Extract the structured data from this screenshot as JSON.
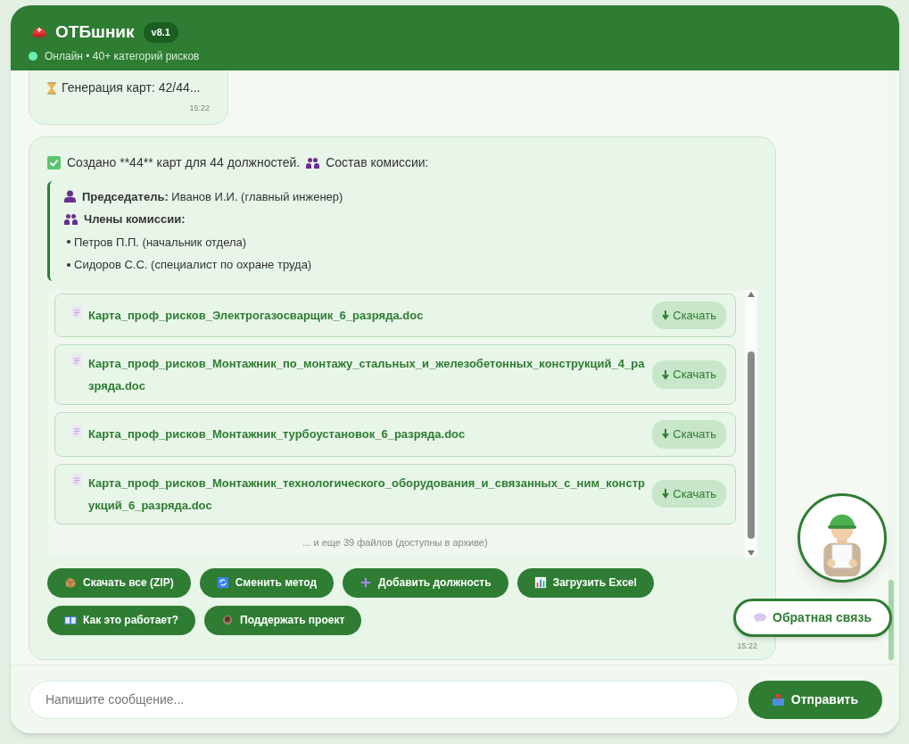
{
  "header": {
    "title": "ОТБшник",
    "version": "v8.1",
    "online": true,
    "status": "Онлайн • 40+ категорий рисков"
  },
  "messages": [
    {
      "text": "Генерация карт: 42/44...",
      "time": "15:22"
    },
    {
      "summary": "Создано **44** карт для 44 должностей.",
      "commission_label": "Состав комиссии:",
      "chairman": "**Председатель:** Иванов И.И. (главный инженер)",
      "members_label": "Члены комиссии:",
      "members": [
        "Петров П.П. (начальник отдела)",
        "Сидоров С.С. (специалист по охране труда)"
      ],
      "files": [
        {
          "name": "Карта_проф_рисков_Электрогазосварщик_6_разряда.doc",
          "button": "Скачать"
        },
        {
          "name": "Карта_проф_рисков_Монтажник_по_монтажу_стальных_и_железобетонных_конструкций_4_разряда.doc",
          "button": "Скачать"
        },
        {
          "name": "Карта_проф_рисков_Монтажник_турбоустановок_6_разряда.doc",
          "button": "Скачать"
        },
        {
          "name": "Карта_проф_рисков_Монтажник_технологического_оборудования_и_связанных_с_ним_конструкций_6_разряда.doc",
          "button": "Скачать"
        }
      ],
      "more": "... и еще 39 файлов (доступны в архиве)",
      "actions": [
        {
          "kind": "box",
          "label": "Скачать все (ZIP)"
        },
        {
          "kind": "refresh",
          "label": "Сменить метод"
        },
        {
          "kind": "plus",
          "label": "Добавить должность"
        },
        {
          "kind": "chart",
          "label": "Загрузить Excel"
        },
        {
          "kind": "book",
          "label": "Как это работает?"
        },
        {
          "kind": "cup",
          "label": "Поддержать проект"
        }
      ],
      "time": "15:22"
    }
  ],
  "feedback": "Обратная связь",
  "composer": {
    "placeholder": "Напишите сообщение...",
    "send": "Отправить"
  }
}
